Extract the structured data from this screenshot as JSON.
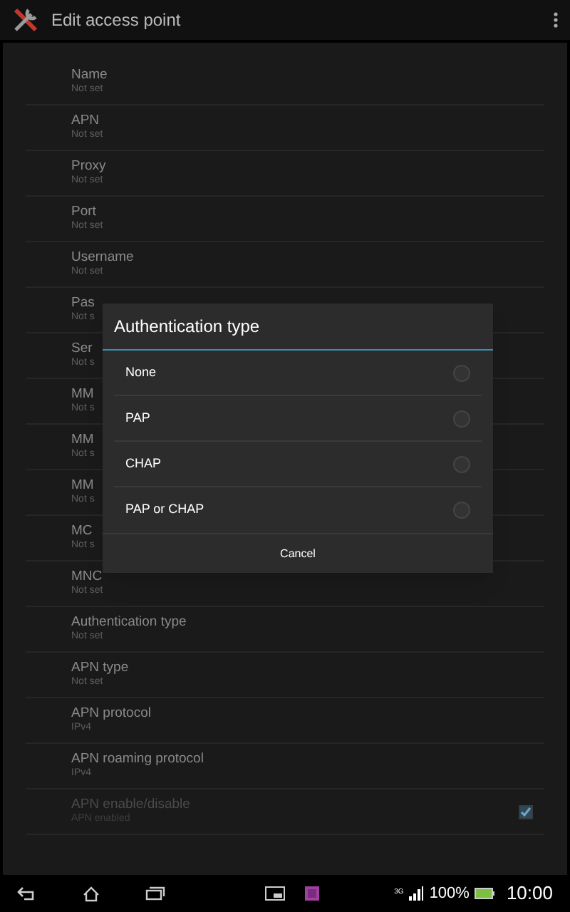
{
  "action_bar": {
    "title": "Edit access point"
  },
  "settings": [
    {
      "title": "Name",
      "summary": "Not set",
      "disabled": false
    },
    {
      "title": "APN",
      "summary": "Not set",
      "disabled": false
    },
    {
      "title": "Proxy",
      "summary": "Not set",
      "disabled": false
    },
    {
      "title": "Port",
      "summary": "Not set",
      "disabled": false
    },
    {
      "title": "Username",
      "summary": "Not set",
      "disabled": false
    },
    {
      "title": "Pas",
      "summary": "Not s",
      "disabled": false
    },
    {
      "title": "Ser",
      "summary": "Not s",
      "disabled": false
    },
    {
      "title": "MM",
      "summary": "Not s",
      "disabled": false
    },
    {
      "title": "MM",
      "summary": "Not s",
      "disabled": false
    },
    {
      "title": "MM",
      "summary": "Not s",
      "disabled": false
    },
    {
      "title": "MC",
      "summary": "Not s",
      "disabled": false
    },
    {
      "title": "MNC",
      "summary": "Not set",
      "disabled": false
    },
    {
      "title": "Authentication type",
      "summary": "Not set",
      "disabled": false
    },
    {
      "title": "APN type",
      "summary": "Not set",
      "disabled": false
    },
    {
      "title": "APN protocol",
      "summary": "IPv4",
      "disabled": false
    },
    {
      "title": "APN roaming protocol",
      "summary": "IPv4",
      "disabled": false
    },
    {
      "title": "APN enable/disable",
      "summary": "APN enabled",
      "disabled": true,
      "checked": true
    }
  ],
  "dialog": {
    "title": "Authentication type",
    "options": [
      {
        "label": "None",
        "selected": false
      },
      {
        "label": "PAP",
        "selected": false
      },
      {
        "label": "CHAP",
        "selected": false
      },
      {
        "label": "PAP or CHAP",
        "selected": false
      }
    ],
    "button": "Cancel"
  },
  "status_bar": {
    "network": "3G",
    "battery": "100%",
    "time": "10:00"
  }
}
